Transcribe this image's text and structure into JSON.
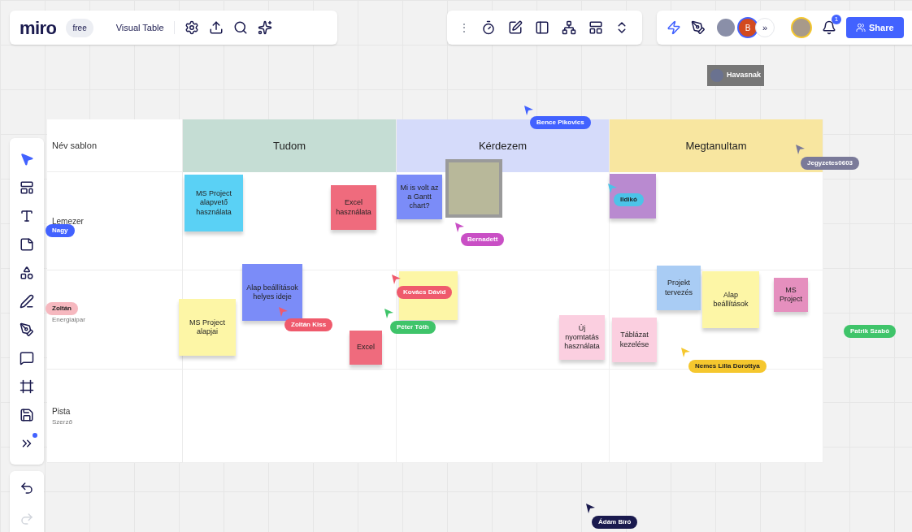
{
  "board": {
    "logo": "miro",
    "plan": "free",
    "title": "Visual Table"
  },
  "toolbar_center": {
    "handle": "⋮"
  },
  "collaborators": {
    "avatar_initial": "B",
    "more": "»",
    "notifications": "1",
    "share": "Share"
  },
  "table": {
    "corner": "Név sablon",
    "columns": [
      {
        "label": "Tudom",
        "color": "#c5ddd4"
      },
      {
        "label": "Kérdezem",
        "color": "#d5dbfa"
      },
      {
        "label": "Megtanultam",
        "color": "#f8e6a0"
      }
    ],
    "rows": [
      {
        "title": "Lemezer"
      },
      {
        "subtitle": "Energiaipar"
      },
      {
        "title": "Pista",
        "subtitle": "Szerző"
      }
    ]
  },
  "stickies": [
    {
      "text": "MS Project alapvető használata",
      "color": "#5ad1f5"
    },
    {
      "text": "Excel használata",
      "color": "#ef6b7d"
    },
    {
      "text": "Mi is volt az a Gantt chart?",
      "color": "#7b8cf8"
    },
    {
      "color": "#b98ad0"
    },
    {
      "text": "Alap beállítások helyes ideje",
      "color": "#7b8cf8"
    },
    {
      "text": "MS Project alapjai",
      "color": "#fdf6a6"
    },
    {
      "text": "Excel",
      "color": "#ef6b7d"
    },
    {
      "color": "#fdf6a6"
    },
    {
      "text": "Új nyomtatás használata",
      "color": "#fbcfe0"
    },
    {
      "text": "Táblázat kezelése",
      "color": "#fbcfe0"
    },
    {
      "text": "Projekt tervezés",
      "color": "#a9ccf4"
    },
    {
      "text": "Alap beállítások",
      "color": "#fdf6a6"
    },
    {
      "text": "MS Project",
      "color": "#e58fbe"
    }
  ],
  "locked_frame": {
    "label": "Havasnak"
  },
  "cursors": [
    {
      "name": "Bence Pikovics",
      "color": "#4262ff"
    },
    {
      "name": "Jegyzetes0603",
      "color": "#7a7a99"
    },
    {
      "name": "Ildikó",
      "color": "#4cc3e8"
    },
    {
      "name": "Bernadett",
      "color": "#c94fc5"
    },
    {
      "name": "Nagy",
      "color": "#4262ff"
    },
    {
      "name": "Zoltán",
      "color": "#f6b8bf"
    },
    {
      "name": "Zoltán Kiss",
      "color": "#ef5a6c"
    },
    {
      "name": "Kovács Dávid",
      "color": "#ef5a6c"
    },
    {
      "name": "Péter Tóth",
      "color": "#3fc46a"
    },
    {
      "name": "Patrik Szabó",
      "color": "#3fc46a"
    },
    {
      "name": "Nemes Lilla Dorottya",
      "color": "#f5c72e"
    },
    {
      "name": "Ádám Bíró",
      "color": "#1a1a4e"
    }
  ]
}
